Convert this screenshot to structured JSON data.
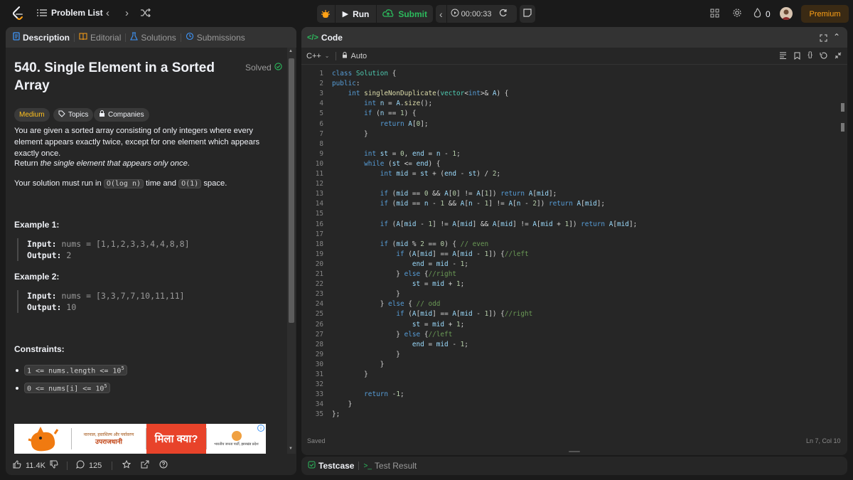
{
  "topbar": {
    "problem_list": "Problem List",
    "run": "Run",
    "submit": "Submit",
    "timer": "00:00:33",
    "streak": "0",
    "premium": "Premium"
  },
  "left_tabs": [
    "Description",
    "Editorial",
    "Solutions",
    "Submissions"
  ],
  "problem": {
    "title": "540. Single Element in a Sorted Array",
    "status": "Solved",
    "difficulty": "Medium",
    "topics": "Topics",
    "companies": "Companies",
    "para1": "You are given a sorted array consisting of only integers where every element appears exactly twice, except for one element which appears exactly once.",
    "para2_a": "Return ",
    "para2_b": "the single element that appears only once",
    "para2_c": ".",
    "para3_a": "Your solution must run in ",
    "para3_code1": "O(log n)",
    "para3_b": " time and ",
    "para3_code2": "O(1)",
    "para3_c": " space.",
    "example1_title": "Example 1:",
    "example1_input_label": "Input:",
    "example1_input": "nums = [1,1,2,3,3,4,4,8,8]",
    "example1_output_label": "Output:",
    "example1_output": "2",
    "example2_title": "Example 2:",
    "example2_input_label": "Input:",
    "example2_input": "nums = [3,3,7,7,10,11,11]",
    "example2_output_label": "Output:",
    "example2_output": "10",
    "constraints_title": "Constraints:",
    "constraint1": "1 <= nums.length <= 10",
    "constraint1_sup": "5",
    "constraint2": "0 <= nums[i] <= 10",
    "constraint2_sup": "5"
  },
  "ad": {
    "text1": "नारनाल, हस्तशिल्प और पर्यावरण",
    "text2": "उपराजधानी",
    "text3": "मिला क्या?",
    "text4": "भारतीय जनता पार्टी, झारखंड प्रदेश"
  },
  "left_footer": {
    "likes": "11.4K",
    "comments": "125"
  },
  "code_panel": {
    "title": "Code",
    "language": "C++",
    "mode": "Auto",
    "saved": "Saved",
    "cursor": "Ln 7, Col 10"
  },
  "bottom_tabs": {
    "testcase": "Testcase",
    "test_result": "Test Result"
  },
  "code_lines": [
    "class Solution {",
    "public:",
    "    int singleNonDuplicate(vector<int>& A) {",
    "        int n = A.size();",
    "        if (n == 1) {",
    "            return A[0];",
    "        }",
    "",
    "        int st = 0, end = n - 1;",
    "        while (st <= end) {",
    "            int mid = st + (end - st) / 2;",
    "",
    "            if (mid == 0 && A[0] != A[1]) return A[mid];",
    "            if (mid == n - 1 && A[n - 1] != A[n - 2]) return A[mid];",
    "",
    "            if (A[mid - 1] != A[mid] && A[mid] != A[mid + 1]) return A[mid];",
    "",
    "            if (mid % 2 == 0) { // even",
    "                if (A[mid] == A[mid - 1]) {//left",
    "                    end = mid - 1;",
    "                } else {//right",
    "                    st = mid + 1;",
    "                }",
    "            } else { // odd",
    "                if (A[mid] == A[mid - 1]) {//right",
    "                    st = mid + 1;",
    "                } else {//left",
    "                    end = mid - 1;",
    "                }",
    "            }",
    "        }",
    "",
    "        return -1;",
    "    }",
    "};"
  ],
  "colors": {
    "accent": "#ffa116",
    "submit_green": "#2cbb5d",
    "solved_green": "#2cbb5d",
    "medium_yellow": "#ffc01e",
    "code_keyword": "#569cd6",
    "code_type": "#4ec9b0"
  }
}
